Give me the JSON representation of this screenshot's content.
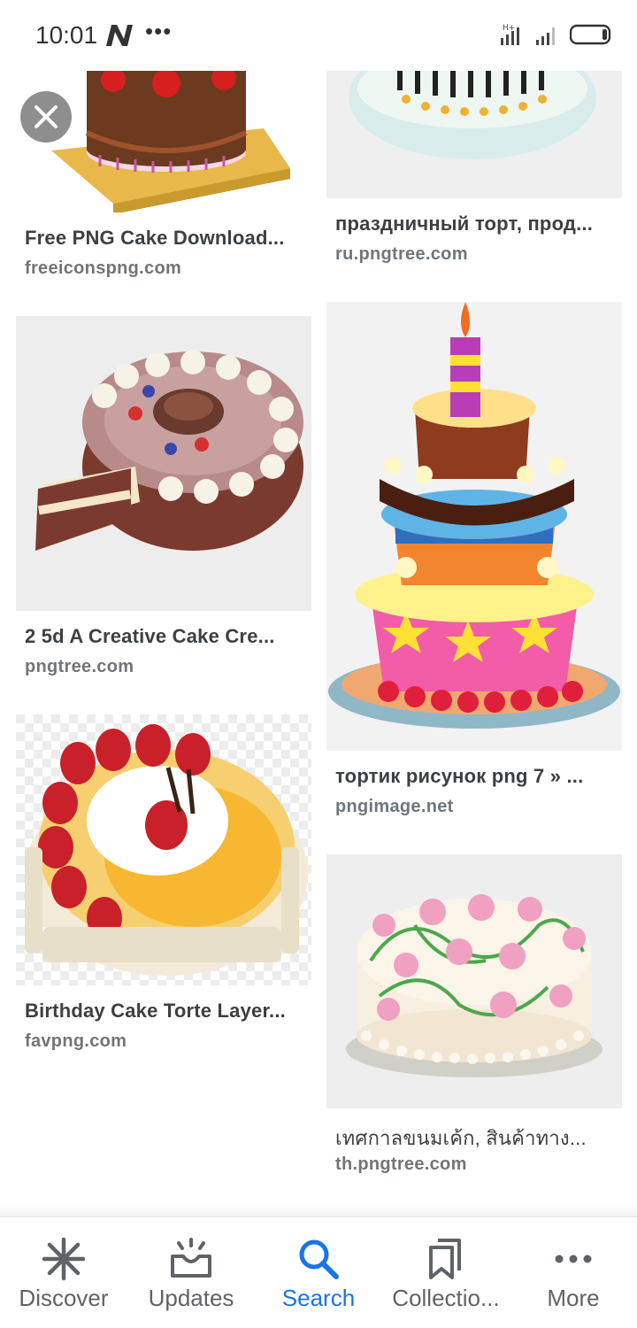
{
  "status_bar": {
    "time": "10:01",
    "dots": "•••"
  },
  "results": [
    {
      "title": "Free PNG Cake Download...",
      "source": "freeiconspng.com"
    },
    {
      "title": "праздничный торт, прод...",
      "source": "ru.pngtree.com"
    },
    {
      "title": "2 5d A Creative Cake Cre...",
      "source": "pngtree.com"
    },
    {
      "title": "тортик рисунок png 7 » ...",
      "source": "pngimage.net"
    },
    {
      "title": "Birthday Cake Torte Layer...",
      "source": "favpng.com"
    },
    {
      "title": "เทศกาลขนมเค้ก, สินค้าทาง...",
      "source": "th.pngtree.com"
    }
  ],
  "bottom_nav": [
    {
      "label": "Discover",
      "icon": "asterisk-icon"
    },
    {
      "label": "Updates",
      "icon": "inbox-bell-icon"
    },
    {
      "label": "Search",
      "icon": "search-icon",
      "active": true
    },
    {
      "label": "Collectio...",
      "icon": "bookmarks-icon"
    },
    {
      "label": "More",
      "icon": "more-dots-icon"
    }
  ],
  "colors": {
    "accent": "#1a73e8",
    "title_text": "#3c4043",
    "source_text": "#70757a",
    "nav_text": "#5f6368"
  }
}
